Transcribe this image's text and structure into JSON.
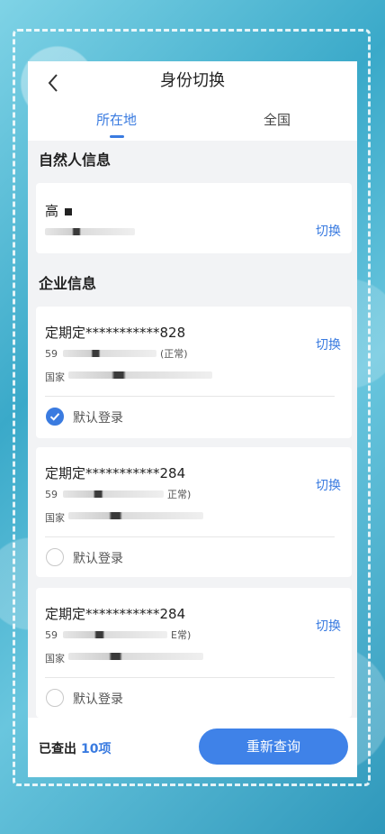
{
  "header": {
    "title": "身份切换",
    "tabs": [
      {
        "label": "所在地",
        "active": true
      },
      {
        "label": "全国",
        "active": false
      }
    ]
  },
  "natural_person": {
    "section_title": "自然人信息",
    "name": "高",
    "switch_label": "切换"
  },
  "enterprise": {
    "section_title": "企业信息",
    "items": [
      {
        "name": "定期定***********828",
        "line1": "59",
        "status": "(正常)",
        "line2": "国家",
        "switch_label": "切换",
        "default_label": "默认登录",
        "checked": true
      },
      {
        "name": "定期定***********284",
        "line1": "59",
        "status": "正常)",
        "line2": "国家",
        "switch_label": "切换",
        "default_label": "默认登录",
        "checked": false
      },
      {
        "name": "定期定***********284",
        "line1": "59",
        "status": "E常)",
        "line2": "国家",
        "switch_label": "切换",
        "default_label": "默认登录",
        "checked": false
      }
    ]
  },
  "footer": {
    "found_label": "已查出",
    "found_count": "10项",
    "requery_button": "重新查询"
  },
  "colors": {
    "accent": "#3a7be0",
    "button": "#3f82e8",
    "panel_bg": "#f2f3f5"
  }
}
